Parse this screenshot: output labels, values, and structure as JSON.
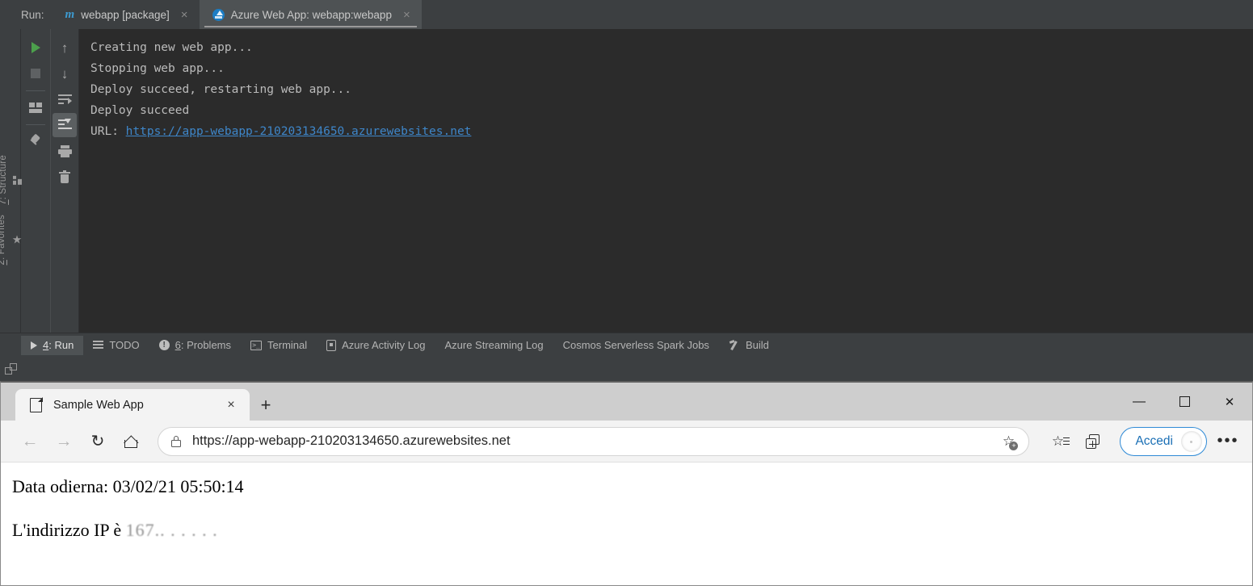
{
  "ide": {
    "run_label": "Run:",
    "run_tabs": [
      {
        "label": "webapp [package]",
        "icon": "maven-icon",
        "active": false,
        "close": "×"
      },
      {
        "label": "Azure Web App: webapp:webapp",
        "icon": "azure-icon",
        "active": true,
        "close": "×"
      }
    ],
    "left_strip": [
      {
        "label_prefix": "7",
        "label": ": Structure",
        "icon": "structure-icon"
      },
      {
        "label_prefix": "2",
        "label": ": Favorites",
        "icon": "star-icon"
      }
    ],
    "gutter_left": [
      {
        "name": "rerun-button",
        "icon": "play-icon"
      },
      {
        "name": "stop-button",
        "icon": "stop-icon"
      },
      {
        "name": "console-view-button",
        "icon": "console-icon"
      },
      {
        "name": "pin-tab-button",
        "icon": "pin-icon"
      }
    ],
    "gutter_right": [
      {
        "name": "up-button",
        "icon": "arrow-up-icon",
        "glyph": "↑"
      },
      {
        "name": "down-button",
        "icon": "arrow-down-icon",
        "glyph": "↓"
      },
      {
        "name": "soft-wrap-button",
        "icon": "soft-wrap-icon"
      },
      {
        "name": "scroll-to-end-button",
        "icon": "scroll-to-end-icon",
        "selected": true
      },
      {
        "name": "print-button",
        "icon": "print-icon"
      },
      {
        "name": "clear-all-button",
        "icon": "trash-icon"
      }
    ],
    "console": {
      "lines": [
        "Creating new web app...",
        "Stopping web app...",
        "Deploy succeed, restarting web app...",
        "Deploy succeed"
      ],
      "url_prefix": "URL: ",
      "url": "https://app-webapp-210203134650.azurewebsites.net",
      "link_color": "#3e86c9",
      "text_color": "#bbbbbb",
      "background": "#2b2b2b"
    },
    "tool_window_tabs": [
      {
        "number": "4",
        "label": ": Run",
        "icon": "play-triangle-icon",
        "active": true
      },
      {
        "number": "",
        "label": "TODO",
        "icon": "todo-icon",
        "active": false
      },
      {
        "number": "6",
        "label": ": Problems",
        "icon": "problems-icon",
        "active": false
      },
      {
        "number": "",
        "label": "Terminal",
        "icon": "terminal-icon",
        "active": false
      },
      {
        "number": "",
        "label": "Azure Activity Log",
        "icon": "azure-log-icon",
        "active": false
      },
      {
        "number": "",
        "label": "Azure Streaming Log",
        "icon": "",
        "active": false
      },
      {
        "number": "",
        "label": "Cosmos Serverless Spark Jobs",
        "icon": "",
        "active": false
      },
      {
        "number": "",
        "label": "Build",
        "icon": "build-icon",
        "active": false
      }
    ],
    "status_bar_icon": "layout-toggle-icon"
  },
  "browser": {
    "tab": {
      "title": "Sample Web App",
      "icon": "page-icon",
      "close": "×"
    },
    "new_tab_label": "+",
    "window_controls": {
      "minimize": "—",
      "maximize": "maximize-icon",
      "close": "✕"
    },
    "toolbar": {
      "back": "←",
      "forward": "→",
      "reload": "↻",
      "home": "home-icon",
      "url": "https://app-webapp-210203134650.azurewebsites.net",
      "lock_icon": "lock-icon",
      "add_favorite_icon": "star-plus-icon",
      "favorites_icon": "favorites-list-icon",
      "collections_icon": "collections-icon",
      "signin_label": "Accedi",
      "signin_accent": "#2e8ad6",
      "more_label": "•••"
    },
    "page": {
      "date_line": "Data odierna: 03/02/21 05:50:14",
      "ip_label": "L'indirizzo IP è ",
      "ip_value": "167.",
      "ip_redacted": ". . . . . ."
    }
  }
}
